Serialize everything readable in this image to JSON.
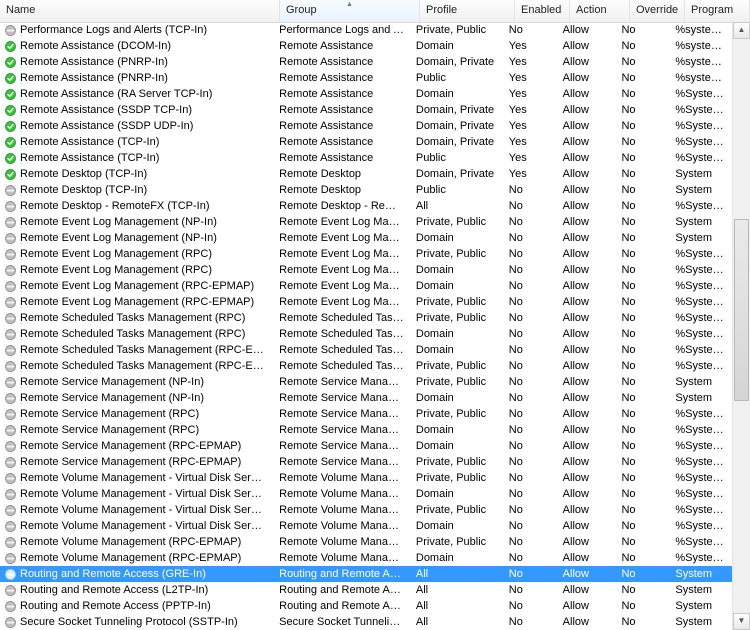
{
  "columns": {
    "name": "Name",
    "group": "Group",
    "profile": "Profile",
    "enabled": "Enabled",
    "action": "Action",
    "override": "Override",
    "program": "Program"
  },
  "sort_column": "group",
  "rows": [
    {
      "enabled": false,
      "name": "Performance Logs and Alerts (TCP-In)",
      "group": "Performance Logs and Alerts",
      "profile": "Private, Public",
      "en": "No",
      "action": "Allow",
      "override": "No",
      "program": "%systemroo"
    },
    {
      "enabled": true,
      "name": "Remote Assistance (DCOM-In)",
      "group": "Remote Assistance",
      "profile": "Domain",
      "en": "Yes",
      "action": "Allow",
      "override": "No",
      "program": "%systemroo"
    },
    {
      "enabled": true,
      "name": "Remote Assistance (PNRP-In)",
      "group": "Remote Assistance",
      "profile": "Domain, Private",
      "en": "Yes",
      "action": "Allow",
      "override": "No",
      "program": "%systemroo"
    },
    {
      "enabled": true,
      "name": "Remote Assistance (PNRP-In)",
      "group": "Remote Assistance",
      "profile": "Public",
      "en": "Yes",
      "action": "Allow",
      "override": "No",
      "program": "%systemroo"
    },
    {
      "enabled": true,
      "name": "Remote Assistance (RA Server TCP-In)",
      "group": "Remote Assistance",
      "profile": "Domain",
      "en": "Yes",
      "action": "Allow",
      "override": "No",
      "program": "%SystemRo"
    },
    {
      "enabled": true,
      "name": "Remote Assistance (SSDP TCP-In)",
      "group": "Remote Assistance",
      "profile": "Domain, Private",
      "en": "Yes",
      "action": "Allow",
      "override": "No",
      "program": "%SystemRo"
    },
    {
      "enabled": true,
      "name": "Remote Assistance (SSDP UDP-In)",
      "group": "Remote Assistance",
      "profile": "Domain, Private",
      "en": "Yes",
      "action": "Allow",
      "override": "No",
      "program": "%SystemRo"
    },
    {
      "enabled": true,
      "name": "Remote Assistance (TCP-In)",
      "group": "Remote Assistance",
      "profile": "Domain, Private",
      "en": "Yes",
      "action": "Allow",
      "override": "No",
      "program": "%SystemRo"
    },
    {
      "enabled": true,
      "name": "Remote Assistance (TCP-In)",
      "group": "Remote Assistance",
      "profile": "Public",
      "en": "Yes",
      "action": "Allow",
      "override": "No",
      "program": "%SystemRo"
    },
    {
      "enabled": true,
      "name": "Remote Desktop (TCP-In)",
      "group": "Remote Desktop",
      "profile": "Domain, Private",
      "en": "Yes",
      "action": "Allow",
      "override": "No",
      "program": "System"
    },
    {
      "enabled": false,
      "name": "Remote Desktop (TCP-In)",
      "group": "Remote Desktop",
      "profile": "Public",
      "en": "No",
      "action": "Allow",
      "override": "No",
      "program": "System"
    },
    {
      "enabled": false,
      "name": "Remote Desktop - RemoteFX (TCP-In)",
      "group": "Remote Desktop - RemoteFX",
      "profile": "All",
      "en": "No",
      "action": "Allow",
      "override": "No",
      "program": "%SystemRo"
    },
    {
      "enabled": false,
      "name": "Remote Event Log Management (NP-In)",
      "group": "Remote Event Log Manage...",
      "profile": "Private, Public",
      "en": "No",
      "action": "Allow",
      "override": "No",
      "program": "System"
    },
    {
      "enabled": false,
      "name": "Remote Event Log Management (NP-In)",
      "group": "Remote Event Log Manage...",
      "profile": "Domain",
      "en": "No",
      "action": "Allow",
      "override": "No",
      "program": "System"
    },
    {
      "enabled": false,
      "name": "Remote Event Log Management (RPC)",
      "group": "Remote Event Log Manage...",
      "profile": "Private, Public",
      "en": "No",
      "action": "Allow",
      "override": "No",
      "program": "%SystemRo"
    },
    {
      "enabled": false,
      "name": "Remote Event Log Management (RPC)",
      "group": "Remote Event Log Manage...",
      "profile": "Domain",
      "en": "No",
      "action": "Allow",
      "override": "No",
      "program": "%SystemRo"
    },
    {
      "enabled": false,
      "name": "Remote Event Log Management (RPC-EPMAP)",
      "group": "Remote Event Log Manage...",
      "profile": "Domain",
      "en": "No",
      "action": "Allow",
      "override": "No",
      "program": "%SystemRo"
    },
    {
      "enabled": false,
      "name": "Remote Event Log Management (RPC-EPMAP)",
      "group": "Remote Event Log Manage...",
      "profile": "Private, Public",
      "en": "No",
      "action": "Allow",
      "override": "No",
      "program": "%SystemRo"
    },
    {
      "enabled": false,
      "name": "Remote Scheduled Tasks Management (RPC)",
      "group": "Remote Scheduled Tasks M...",
      "profile": "Private, Public",
      "en": "No",
      "action": "Allow",
      "override": "No",
      "program": "%SystemRo"
    },
    {
      "enabled": false,
      "name": "Remote Scheduled Tasks Management (RPC)",
      "group": "Remote Scheduled Tasks M...",
      "profile": "Domain",
      "en": "No",
      "action": "Allow",
      "override": "No",
      "program": "%SystemRo"
    },
    {
      "enabled": false,
      "name": "Remote Scheduled Tasks Management (RPC-EPMAP)",
      "group": "Remote Scheduled Tasks M...",
      "profile": "Domain",
      "en": "No",
      "action": "Allow",
      "override": "No",
      "program": "%SystemRo"
    },
    {
      "enabled": false,
      "name": "Remote Scheduled Tasks Management (RPC-EPMAP)",
      "group": "Remote Scheduled Tasks M...",
      "profile": "Private, Public",
      "en": "No",
      "action": "Allow",
      "override": "No",
      "program": "%SystemRo"
    },
    {
      "enabled": false,
      "name": "Remote Service Management (NP-In)",
      "group": "Remote Service Management",
      "profile": "Private, Public",
      "en": "No",
      "action": "Allow",
      "override": "No",
      "program": "System"
    },
    {
      "enabled": false,
      "name": "Remote Service Management (NP-In)",
      "group": "Remote Service Management",
      "profile": "Domain",
      "en": "No",
      "action": "Allow",
      "override": "No",
      "program": "System"
    },
    {
      "enabled": false,
      "name": "Remote Service Management (RPC)",
      "group": "Remote Service Management",
      "profile": "Private, Public",
      "en": "No",
      "action": "Allow",
      "override": "No",
      "program": "%SystemRo"
    },
    {
      "enabled": false,
      "name": "Remote Service Management (RPC)",
      "group": "Remote Service Management",
      "profile": "Domain",
      "en": "No",
      "action": "Allow",
      "override": "No",
      "program": "%SystemRo"
    },
    {
      "enabled": false,
      "name": "Remote Service Management (RPC-EPMAP)",
      "group": "Remote Service Management",
      "profile": "Domain",
      "en": "No",
      "action": "Allow",
      "override": "No",
      "program": "%SystemRo"
    },
    {
      "enabled": false,
      "name": "Remote Service Management (RPC-EPMAP)",
      "group": "Remote Service Management",
      "profile": "Private, Public",
      "en": "No",
      "action": "Allow",
      "override": "No",
      "program": "%SystemRo"
    },
    {
      "enabled": false,
      "name": "Remote Volume Management - Virtual Disk Service (RP...",
      "group": "Remote Volume Manageme...",
      "profile": "Private, Public",
      "en": "No",
      "action": "Allow",
      "override": "No",
      "program": "%SystemRo"
    },
    {
      "enabled": false,
      "name": "Remote Volume Management - Virtual Disk Service (RP...",
      "group": "Remote Volume Manageme...",
      "profile": "Domain",
      "en": "No",
      "action": "Allow",
      "override": "No",
      "program": "%SystemRo"
    },
    {
      "enabled": false,
      "name": "Remote Volume Management - Virtual Disk Service Lo...",
      "group": "Remote Volume Manageme...",
      "profile": "Private, Public",
      "en": "No",
      "action": "Allow",
      "override": "No",
      "program": "%SystemRo"
    },
    {
      "enabled": false,
      "name": "Remote Volume Management - Virtual Disk Service Lo...",
      "group": "Remote Volume Manageme...",
      "profile": "Domain",
      "en": "No",
      "action": "Allow",
      "override": "No",
      "program": "%SystemRo"
    },
    {
      "enabled": false,
      "name": "Remote Volume Management (RPC-EPMAP)",
      "group": "Remote Volume Manageme...",
      "profile": "Private, Public",
      "en": "No",
      "action": "Allow",
      "override": "No",
      "program": "%SystemRo"
    },
    {
      "enabled": false,
      "name": "Remote Volume Management (RPC-EPMAP)",
      "group": "Remote Volume Manageme...",
      "profile": "Domain",
      "en": "No",
      "action": "Allow",
      "override": "No",
      "program": "%SystemRo"
    },
    {
      "enabled": false,
      "selected": true,
      "name": "Routing and Remote Access (GRE-In)",
      "group": "Routing and Remote Access",
      "profile": "All",
      "en": "No",
      "action": "Allow",
      "override": "No",
      "program": "System"
    },
    {
      "enabled": false,
      "name": "Routing and Remote Access (L2TP-In)",
      "group": "Routing and Remote Access",
      "profile": "All",
      "en": "No",
      "action": "Allow",
      "override": "No",
      "program": "System"
    },
    {
      "enabled": false,
      "name": "Routing and Remote Access (PPTP-In)",
      "group": "Routing and Remote Access",
      "profile": "All",
      "en": "No",
      "action": "Allow",
      "override": "No",
      "program": "System"
    },
    {
      "enabled": false,
      "name": "Secure Socket Tunneling Protocol (SSTP-In)",
      "group": "Secure Socket Tunneling Pr...",
      "profile": "All",
      "en": "No",
      "action": "Allow",
      "override": "No",
      "program": "System"
    }
  ]
}
